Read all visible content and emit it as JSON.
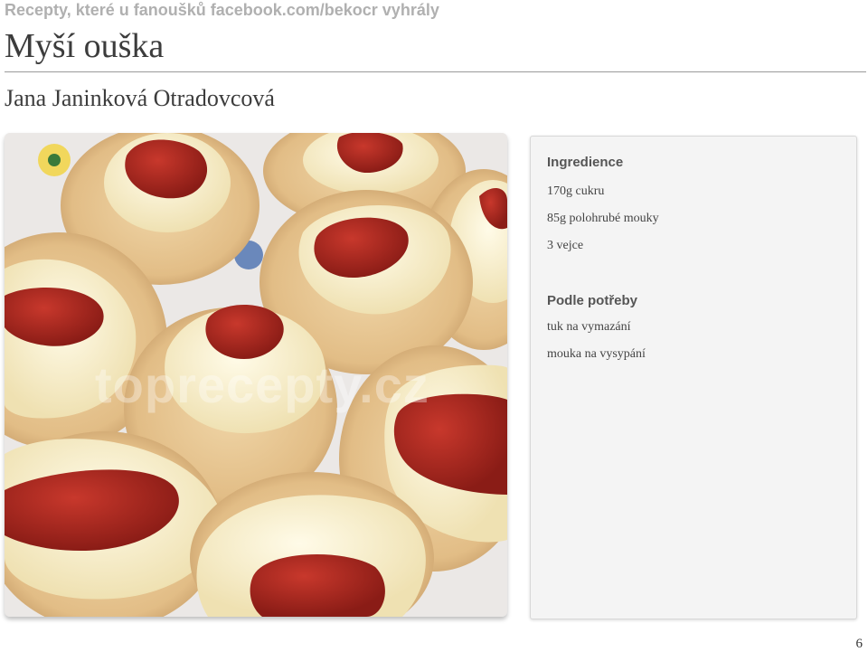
{
  "header": {
    "source_line": "Recepty, které u fanoušků facebook.com/bekocr vyhrály"
  },
  "recipe": {
    "title": "Myší ouška",
    "author": "Jana Janinková Otradovcová"
  },
  "photo": {
    "subject": "cookies with cream and jam",
    "watermark": "toprecepty.cz"
  },
  "ingredients_card": {
    "sections": [
      {
        "title": "Ingredience",
        "items": [
          "170g cukru",
          "85g polohrubé mouky",
          "3 vejce"
        ]
      },
      {
        "title": "Podle potřeby",
        "items": [
          "tuk na vymazání",
          "mouka na vysypání"
        ]
      }
    ]
  },
  "footer": {
    "page_number": "6"
  },
  "colors": {
    "cookie": "#e8c89a",
    "cream": "#fbf4d6",
    "jam": "#a8251e",
    "plate": "#e9e6e3"
  }
}
